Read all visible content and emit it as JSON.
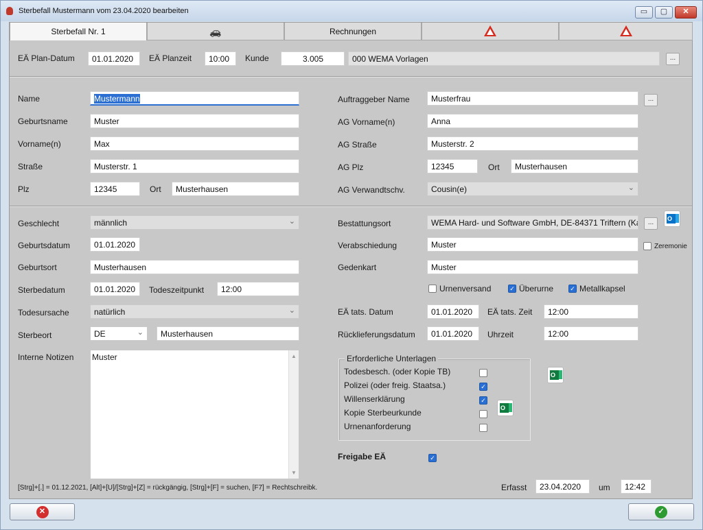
{
  "window": {
    "title": "Sterbefall Mustermann vom 23.04.2020 bearbeiten",
    "minimize": "▭",
    "maximize": "▢",
    "close": "✕"
  },
  "tabs": [
    {
      "label": "Sterbefall Nr. 1",
      "icon": ""
    },
    {
      "label": "",
      "icon": "car-icon"
    },
    {
      "label": "Rechnungen",
      "icon": ""
    },
    {
      "label": "",
      "icon": "warning-icon"
    },
    {
      "label": "",
      "icon": "warning-icon"
    }
  ],
  "top": {
    "plan_date_label": "EÄ Plan-Datum",
    "plan_date": "01.01.2020",
    "plan_time_label": "EÄ Planzeit",
    "plan_time": "10:00",
    "customer_label": "Kunde",
    "customer_no": "3.005",
    "customer_name": "000 WEMA Vorlagen",
    "ellipsis": "..."
  },
  "person": {
    "name_label": "Name",
    "name": "Mustermann",
    "birthname_label": "Geburtsname",
    "birthname": "Muster",
    "firstname_label": "Vorname(n)",
    "firstname": "Max",
    "street_label": "Straße",
    "street": "Musterstr. 1",
    "zip_label": "Plz",
    "zip": "12345",
    "city_label": "Ort",
    "city": "Musterhausen"
  },
  "client": {
    "name_label": "Auftraggeber Name",
    "name": "Musterfrau",
    "firstname_label": "AG Vorname(n)",
    "firstname": "Anna",
    "street_label": "AG Straße",
    "street": "Musterstr. 2",
    "zip_label": "AG Plz",
    "zip": "12345",
    "city_label": "Ort",
    "city": "Musterhausen",
    "relation_label": "AG Verwandtschv.",
    "relation": "Cousin(e)"
  },
  "details": {
    "gender_label": "Geschlecht",
    "gender": "männlich",
    "birthdate_label": "Geburtsdatum",
    "birthdate": "01.01.2020",
    "birthplace_label": "Geburtsort",
    "birthplace": "Musterhausen",
    "deathdate_label": "Sterbedatum",
    "deathdate": "01.01.2020",
    "deathtime_label": "Todeszeitpunkt",
    "deathtime": "12:00",
    "cause_label": "Todesursache",
    "cause": "natürlich",
    "deathplace_label": "Sterbeort",
    "country": "DE",
    "deathplace": "Musterhausen",
    "notes_label": "Interne Notizen",
    "notes": "Muster"
  },
  "funeral": {
    "place_label": "Bestattungsort",
    "place": "WEMA Hard- und Software GmbH, DE-84371 Triftern (Ka",
    "farewell_label": "Verabschiedung",
    "farewell": "Muster",
    "ceremony_label": "Zeremonie",
    "ceremony": false,
    "card_label": "Gedenkart",
    "card": "Muster",
    "urn_shipping_label": "Urnenversand",
    "urn_shipping": false,
    "overurn_label": "Überurne",
    "overurn": true,
    "metal_label": "Metallkapsel",
    "metal": true,
    "actual_date_label": "EÄ tats. Datum",
    "actual_date": "01.01.2020",
    "actual_time_label": "EÄ tats. Zeit",
    "actual_time": "12:00",
    "return_date_label": "Rücklieferungsdatum",
    "return_date": "01.01.2020",
    "return_time_label": "Uhrzeit",
    "return_time": "12:00"
  },
  "documents": {
    "caption": "Erforderliche Unterlagen",
    "items": [
      {
        "label": "Todesbesch. (oder Kopie TB)",
        "checked": false
      },
      {
        "label": "Polizei (oder freig. Staatsa.)",
        "checked": true
      },
      {
        "label": "Willenserklärung",
        "checked": true
      },
      {
        "label": "Kopie Sterbeurkunde",
        "checked": false
      },
      {
        "label": "Urnenanforderung",
        "checked": false
      }
    ]
  },
  "release": {
    "label": "Freigabe EÄ",
    "checked": true
  },
  "footer": {
    "hint": "[Strg]+[.] = 01.12.2021, [Alt]+[U]/[Strg]+[Z] = rückgängig, [Strg]+[F] = suchen, [F7] = Rechtschreibk.",
    "captured_label": "Erfasst",
    "captured_date": "23.04.2020",
    "at_label": "um",
    "captured_time": "12:42"
  },
  "buttons": {
    "cancel": "✕",
    "ok": "✓"
  },
  "glyphs": {
    "check": "✓",
    "chevron": "⌄",
    "up": "▲",
    "down": "▼",
    "car": "🚗"
  },
  "colors": {
    "accent": "#2a6fd1",
    "cancel": "#d32f2f",
    "ok": "#2e9b32",
    "warning": "#d62b1f"
  }
}
